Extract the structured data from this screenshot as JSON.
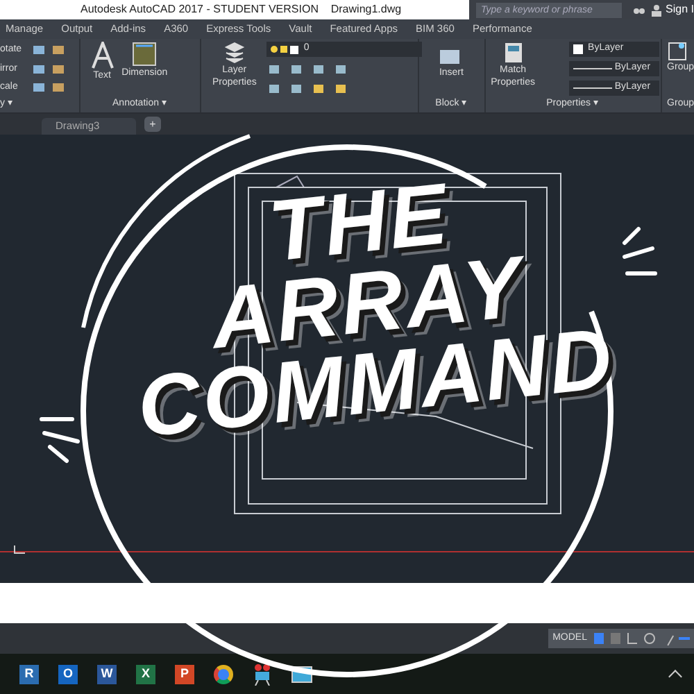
{
  "title_bar": {
    "title": "Autodesk AutoCAD 2017 - STUDENT VERSION    Drawing1.dwg",
    "search": {
      "placeholder": "Type a keyword or phrase"
    },
    "sign_in": "Sign I"
  },
  "ribbon_tabs": [
    {
      "label": "Manage",
      "selected": false
    },
    {
      "label": "Output",
      "selected": false
    },
    {
      "label": "Add-ins",
      "selected": false
    },
    {
      "label": "A360",
      "selected": false
    },
    {
      "label": "Express Tools",
      "selected": false
    },
    {
      "label": "Vault",
      "selected": false
    },
    {
      "label": "Featured Apps",
      "selected": false
    },
    {
      "label": "BIM 360",
      "selected": false
    },
    {
      "label": "Performance",
      "selected": false
    }
  ],
  "modify_panel": {
    "tools": [
      "otate",
      "irror",
      "cale"
    ],
    "label": "y ▾"
  },
  "annotation_panel": {
    "text_tool": "Text",
    "dimension_tool": "Dimension",
    "label": "Annotation ▾"
  },
  "layers_panel": {
    "layer_properties": "Layer Properties",
    "current_layer": "0"
  },
  "block_panel": {
    "insert": "Insert",
    "label": "Block ▾"
  },
  "properties_panel": {
    "match_properties": "Match Properties",
    "dropdowns": [
      "ByLayer",
      "ByLayer",
      "ByLayer"
    ],
    "label": "Properties ▾"
  },
  "groups_panel": {
    "group": "Group",
    "label": "Group"
  },
  "document_tabs": [
    {
      "label": "Drawing3",
      "selected": false
    }
  ],
  "new_tab": "+",
  "overlay": {
    "title_lines": [
      "THE",
      "ARRAY",
      "COMMAND"
    ]
  },
  "status_bar": {
    "model": "MODEL"
  },
  "taskbar": [
    {
      "label": "R",
      "color": "#2b6cb0",
      "kind": "letter"
    },
    {
      "label": "O",
      "color": "#1565c0",
      "kind": "letter"
    },
    {
      "label": "W",
      "color": "#2b579a",
      "kind": "letter"
    },
    {
      "label": "X",
      "color": "#217346",
      "kind": "letter"
    },
    {
      "label": "P",
      "color": "#d24726",
      "kind": "letter"
    },
    {
      "kind": "chrome"
    },
    {
      "kind": "projector"
    },
    {
      "kind": "monitor"
    }
  ]
}
